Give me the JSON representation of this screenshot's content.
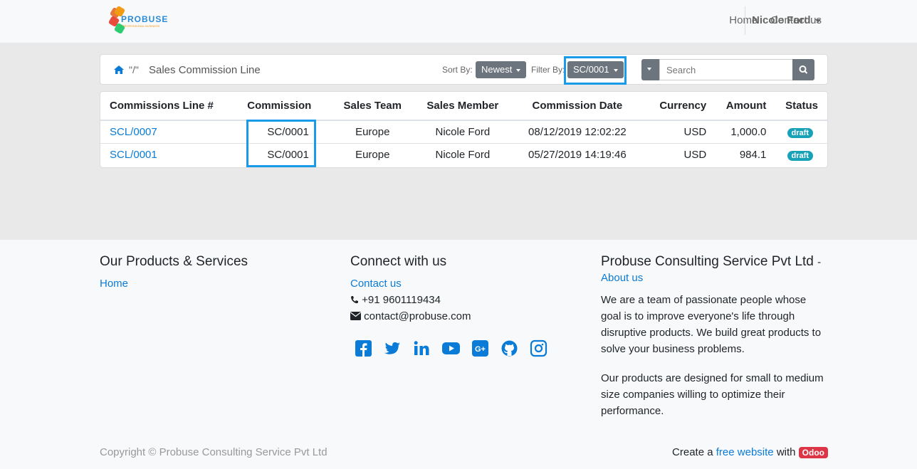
{
  "header": {
    "logo_text": "PROBUSE",
    "logo_subtext": "PROFESSIONAL BUSINESS",
    "nav": [
      "Home",
      "Contact us"
    ],
    "user": "Nicole Ford"
  },
  "toolbar": {
    "breadcrumb_separator": "\"/\"",
    "breadcrumb_title": "Sales Commission Line",
    "sort_label": "Sort By:",
    "sort_value": "Newest",
    "filter_label": "Filter By:",
    "filter_value": "SC/0001",
    "search_placeholder": "Search"
  },
  "table": {
    "headers": [
      "Commissions Line #",
      "Commission",
      "Sales Team",
      "Sales Member",
      "Commission Date",
      "Currency",
      "Amount",
      "Status"
    ],
    "rows": [
      {
        "line": "SCL/0007",
        "commission": "SC/0001",
        "team": "Europe",
        "member": "Nicole Ford",
        "date": "08/12/2019 12:02:22",
        "currency": "USD",
        "amount": "1,000.0",
        "status": "draft"
      },
      {
        "line": "SCL/0001",
        "commission": "SC/0001",
        "team": "Europe",
        "member": "Nicole Ford",
        "date": "05/27/2019 14:19:46",
        "currency": "USD",
        "amount": "984.1",
        "status": "draft"
      }
    ]
  },
  "footer": {
    "col1_title": "Our Products & Services",
    "col1_link": "Home",
    "col2_title": "Connect with us",
    "col2_link": "Contact us",
    "phone": "+91 9601119434",
    "email": "contact@probuse.com",
    "social_icons": [
      "facebook-icon",
      "twitter-icon",
      "linkedin-icon",
      "youtube-icon",
      "google-plus-icon",
      "github-icon",
      "instagram-icon"
    ],
    "col3_title": "Probuse Consulting Service Pvt Ltd",
    "col3_title_sep": "-",
    "col3_link": "About us",
    "about_p1": "We are a team of passionate people whose goal is to improve everyone's life through disruptive products. We build great products to solve your business problems.",
    "about_p2": "Our products are designed for small to medium size companies willing to optimize their performance.",
    "copyright": "Copyright © Probuse Consulting Service Pvt Ltd",
    "credit_prefix": "Create a",
    "credit_link": "free website",
    "credit_mid": "with",
    "credit_badge": "Odoo"
  },
  "colors": {
    "accent": "#0a7bd6",
    "highlight": "#1a9bea",
    "badge": "#17a2b8",
    "odoo": "#dc3545"
  }
}
